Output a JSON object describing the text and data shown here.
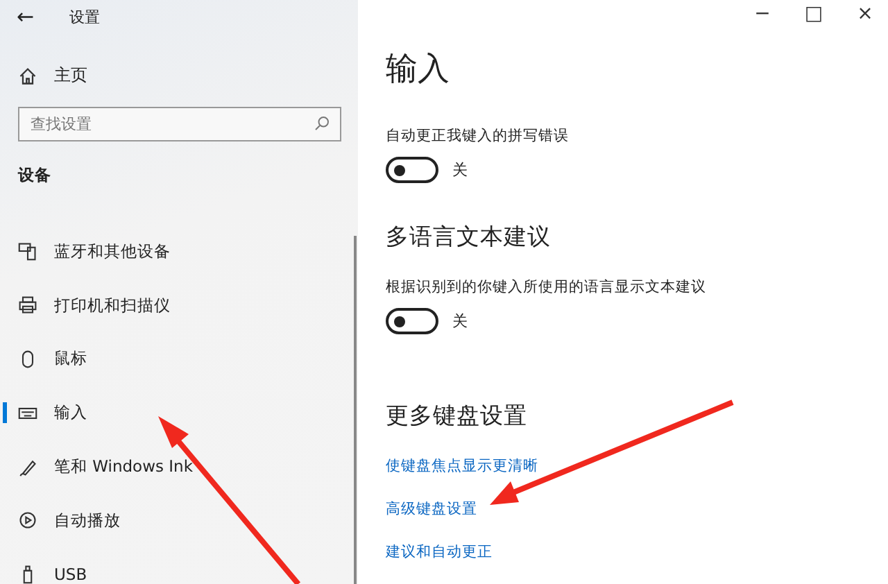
{
  "window": {
    "back": "←",
    "title": "设置",
    "controls": [
      "−",
      "□",
      "×"
    ]
  },
  "sidebar": {
    "home": "主页",
    "search": {
      "placeholder": "查找设置"
    },
    "section": "设备",
    "items": [
      {
        "label": "蓝牙和其他设备",
        "kind": "bluetooth",
        "selected": false
      },
      {
        "label": "打印机和扫描仪",
        "kind": "printer",
        "selected": false
      },
      {
        "label": "鼠标",
        "kind": "mouse",
        "selected": false
      },
      {
        "label": "输入",
        "kind": "keyboard",
        "selected": true
      },
      {
        "label": "笔和 Windows Ink",
        "kind": "pen",
        "selected": false
      },
      {
        "label": "自动播放",
        "kind": "autoplay",
        "selected": false
      },
      {
        "label": "USB",
        "kind": "usb",
        "selected": false
      }
    ]
  },
  "page": {
    "title": "输入",
    "settings": [
      {
        "kind": "toggle",
        "label": "自动更正我键入的拼写错误",
        "on": false,
        "state": "关"
      },
      {
        "kind": "heading",
        "label": "多语言文本建议"
      },
      {
        "kind": "toggle",
        "label": "根据识别到的你键入所使用的语言显示文本建议",
        "on": false,
        "state": "关"
      },
      {
        "kind": "heading",
        "label": "更多键盘设置"
      },
      {
        "kind": "link",
        "label": "使键盘焦点显示更清晰"
      },
      {
        "kind": "link",
        "label": "高级键盘设置"
      },
      {
        "kind": "link",
        "label": "建议和自动更正"
      }
    ]
  }
}
